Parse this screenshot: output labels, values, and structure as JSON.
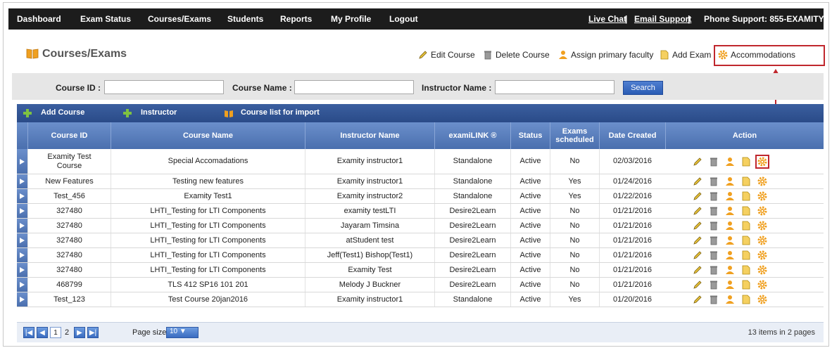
{
  "nav": {
    "items": [
      "Dashboard",
      "Exam Status",
      "Courses/Exams",
      "Students",
      "Reports",
      "My Profile",
      "Logout"
    ],
    "live_chat": "Live Chat",
    "sep1": "|",
    "email_support": "Email Support",
    "sep2": "|",
    "phone": "Phone Support: 855-EXAMITY"
  },
  "page": {
    "title": "Courses/Exams"
  },
  "toolbar": {
    "edit_course": "Edit Course",
    "delete_course": "Delete Course",
    "assign_faculty": "Assign primary faculty",
    "add_exam": "Add Exam",
    "accommodations": "Accommodations"
  },
  "search": {
    "course_id_label": "Course ID :",
    "course_id_value": "",
    "course_name_label": "Course Name :",
    "course_name_value": "",
    "instructor_label": "Instructor Name :",
    "instructor_value": "",
    "button": "Search"
  },
  "grid_toolbar": {
    "add_course": "Add Course",
    "instructor": "Instructor",
    "course_list": "Course list for import"
  },
  "columns": [
    "Course ID",
    "Course Name",
    "Instructor Name",
    "examiLINK ®",
    "Status",
    "Exams scheduled",
    "Date Created",
    "Action"
  ],
  "rows": [
    {
      "id": "Examity Test Course",
      "name": "Special Accomadations",
      "instructor": "Examity instructor1",
      "link": "Standalone",
      "status": "Active",
      "scheduled": "No",
      "date": "02/03/2016"
    },
    {
      "id": "New Features",
      "name": "Testing new features",
      "instructor": "Examity instructor1",
      "link": "Standalone",
      "status": "Active",
      "scheduled": "Yes",
      "date": "01/24/2016"
    },
    {
      "id": "Test_456",
      "name": "Examity Test1",
      "instructor": "Examity instructor2",
      "link": "Standalone",
      "status": "Active",
      "scheduled": "Yes",
      "date": "01/22/2016"
    },
    {
      "id": "327480",
      "name": "LHTI_Testing for LTI Components",
      "instructor": "examity testLTI",
      "link": "Desire2Learn",
      "status": "Active",
      "scheduled": "No",
      "date": "01/21/2016"
    },
    {
      "id": "327480",
      "name": "LHTI_Testing for LTI Components",
      "instructor": "Jayaram Timsina",
      "link": "Desire2Learn",
      "status": "Active",
      "scheduled": "No",
      "date": "01/21/2016"
    },
    {
      "id": "327480",
      "name": "LHTI_Testing for LTI Components",
      "instructor": "atStudent test",
      "link": "Desire2Learn",
      "status": "Active",
      "scheduled": "No",
      "date": "01/21/2016"
    },
    {
      "id": "327480",
      "name": "LHTI_Testing for LTI Components",
      "instructor": "Jeff(Test1) Bishop(Test1)",
      "link": "Desire2Learn",
      "status": "Active",
      "scheduled": "No",
      "date": "01/21/2016"
    },
    {
      "id": "327480",
      "name": "LHTI_Testing for LTI Components",
      "instructor": "Examity Test",
      "link": "Desire2Learn",
      "status": "Active",
      "scheduled": "No",
      "date": "01/21/2016"
    },
    {
      "id": "468799",
      "name": "TLS 412 SP16 101 201",
      "instructor": "Melody J Buckner",
      "link": "Desire2Learn",
      "status": "Active",
      "scheduled": "No",
      "date": "01/21/2016"
    },
    {
      "id": "Test_123",
      "name": "Test Course 20jan2016",
      "instructor": "Examity instructor1",
      "link": "Standalone",
      "status": "Active",
      "scheduled": "Yes",
      "date": "01/20/2016"
    }
  ],
  "pager": {
    "page1": "1",
    "page2": "2",
    "size_label": "Page size:",
    "size_value": "10",
    "info": "13 items in 2 pages"
  },
  "colors": {
    "nav_bg": "#1c1c1c",
    "grid_header": "#4a6fae",
    "highlight": "#c0272d",
    "icon_orange": "#f0a020"
  }
}
